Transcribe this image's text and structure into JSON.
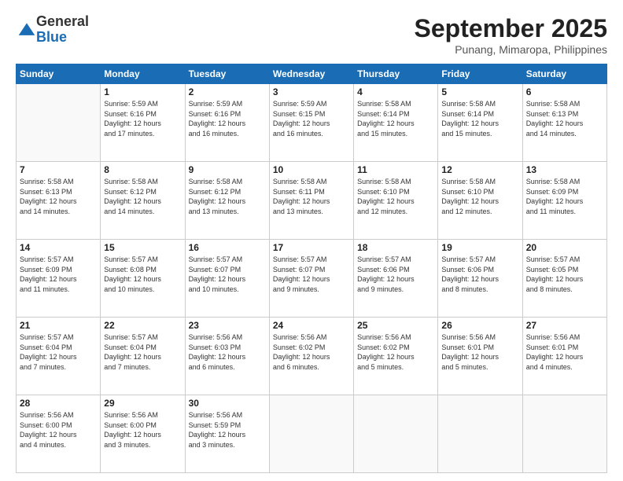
{
  "logo": {
    "general": "General",
    "blue": "Blue"
  },
  "header": {
    "month": "September 2025",
    "location": "Punang, Mimaropa, Philippines"
  },
  "weekdays": [
    "Sunday",
    "Monday",
    "Tuesday",
    "Wednesday",
    "Thursday",
    "Friday",
    "Saturday"
  ],
  "weeks": [
    [
      {
        "day": "",
        "info": ""
      },
      {
        "day": "1",
        "info": "Sunrise: 5:59 AM\nSunset: 6:16 PM\nDaylight: 12 hours\nand 17 minutes."
      },
      {
        "day": "2",
        "info": "Sunrise: 5:59 AM\nSunset: 6:16 PM\nDaylight: 12 hours\nand 16 minutes."
      },
      {
        "day": "3",
        "info": "Sunrise: 5:59 AM\nSunset: 6:15 PM\nDaylight: 12 hours\nand 16 minutes."
      },
      {
        "day": "4",
        "info": "Sunrise: 5:58 AM\nSunset: 6:14 PM\nDaylight: 12 hours\nand 15 minutes."
      },
      {
        "day": "5",
        "info": "Sunrise: 5:58 AM\nSunset: 6:14 PM\nDaylight: 12 hours\nand 15 minutes."
      },
      {
        "day": "6",
        "info": "Sunrise: 5:58 AM\nSunset: 6:13 PM\nDaylight: 12 hours\nand 14 minutes."
      }
    ],
    [
      {
        "day": "7",
        "info": "Sunrise: 5:58 AM\nSunset: 6:13 PM\nDaylight: 12 hours\nand 14 minutes."
      },
      {
        "day": "8",
        "info": "Sunrise: 5:58 AM\nSunset: 6:12 PM\nDaylight: 12 hours\nand 14 minutes."
      },
      {
        "day": "9",
        "info": "Sunrise: 5:58 AM\nSunset: 6:12 PM\nDaylight: 12 hours\nand 13 minutes."
      },
      {
        "day": "10",
        "info": "Sunrise: 5:58 AM\nSunset: 6:11 PM\nDaylight: 12 hours\nand 13 minutes."
      },
      {
        "day": "11",
        "info": "Sunrise: 5:58 AM\nSunset: 6:10 PM\nDaylight: 12 hours\nand 12 minutes."
      },
      {
        "day": "12",
        "info": "Sunrise: 5:58 AM\nSunset: 6:10 PM\nDaylight: 12 hours\nand 12 minutes."
      },
      {
        "day": "13",
        "info": "Sunrise: 5:58 AM\nSunset: 6:09 PM\nDaylight: 12 hours\nand 11 minutes."
      }
    ],
    [
      {
        "day": "14",
        "info": "Sunrise: 5:57 AM\nSunset: 6:09 PM\nDaylight: 12 hours\nand 11 minutes."
      },
      {
        "day": "15",
        "info": "Sunrise: 5:57 AM\nSunset: 6:08 PM\nDaylight: 12 hours\nand 10 minutes."
      },
      {
        "day": "16",
        "info": "Sunrise: 5:57 AM\nSunset: 6:07 PM\nDaylight: 12 hours\nand 10 minutes."
      },
      {
        "day": "17",
        "info": "Sunrise: 5:57 AM\nSunset: 6:07 PM\nDaylight: 12 hours\nand 9 minutes."
      },
      {
        "day": "18",
        "info": "Sunrise: 5:57 AM\nSunset: 6:06 PM\nDaylight: 12 hours\nand 9 minutes."
      },
      {
        "day": "19",
        "info": "Sunrise: 5:57 AM\nSunset: 6:06 PM\nDaylight: 12 hours\nand 8 minutes."
      },
      {
        "day": "20",
        "info": "Sunrise: 5:57 AM\nSunset: 6:05 PM\nDaylight: 12 hours\nand 8 minutes."
      }
    ],
    [
      {
        "day": "21",
        "info": "Sunrise: 5:57 AM\nSunset: 6:04 PM\nDaylight: 12 hours\nand 7 minutes."
      },
      {
        "day": "22",
        "info": "Sunrise: 5:57 AM\nSunset: 6:04 PM\nDaylight: 12 hours\nand 7 minutes."
      },
      {
        "day": "23",
        "info": "Sunrise: 5:56 AM\nSunset: 6:03 PM\nDaylight: 12 hours\nand 6 minutes."
      },
      {
        "day": "24",
        "info": "Sunrise: 5:56 AM\nSunset: 6:02 PM\nDaylight: 12 hours\nand 6 minutes."
      },
      {
        "day": "25",
        "info": "Sunrise: 5:56 AM\nSunset: 6:02 PM\nDaylight: 12 hours\nand 5 minutes."
      },
      {
        "day": "26",
        "info": "Sunrise: 5:56 AM\nSunset: 6:01 PM\nDaylight: 12 hours\nand 5 minutes."
      },
      {
        "day": "27",
        "info": "Sunrise: 5:56 AM\nSunset: 6:01 PM\nDaylight: 12 hours\nand 4 minutes."
      }
    ],
    [
      {
        "day": "28",
        "info": "Sunrise: 5:56 AM\nSunset: 6:00 PM\nDaylight: 12 hours\nand 4 minutes."
      },
      {
        "day": "29",
        "info": "Sunrise: 5:56 AM\nSunset: 6:00 PM\nDaylight: 12 hours\nand 3 minutes."
      },
      {
        "day": "30",
        "info": "Sunrise: 5:56 AM\nSunset: 5:59 PM\nDaylight: 12 hours\nand 3 minutes."
      },
      {
        "day": "",
        "info": ""
      },
      {
        "day": "",
        "info": ""
      },
      {
        "day": "",
        "info": ""
      },
      {
        "day": "",
        "info": ""
      }
    ]
  ]
}
